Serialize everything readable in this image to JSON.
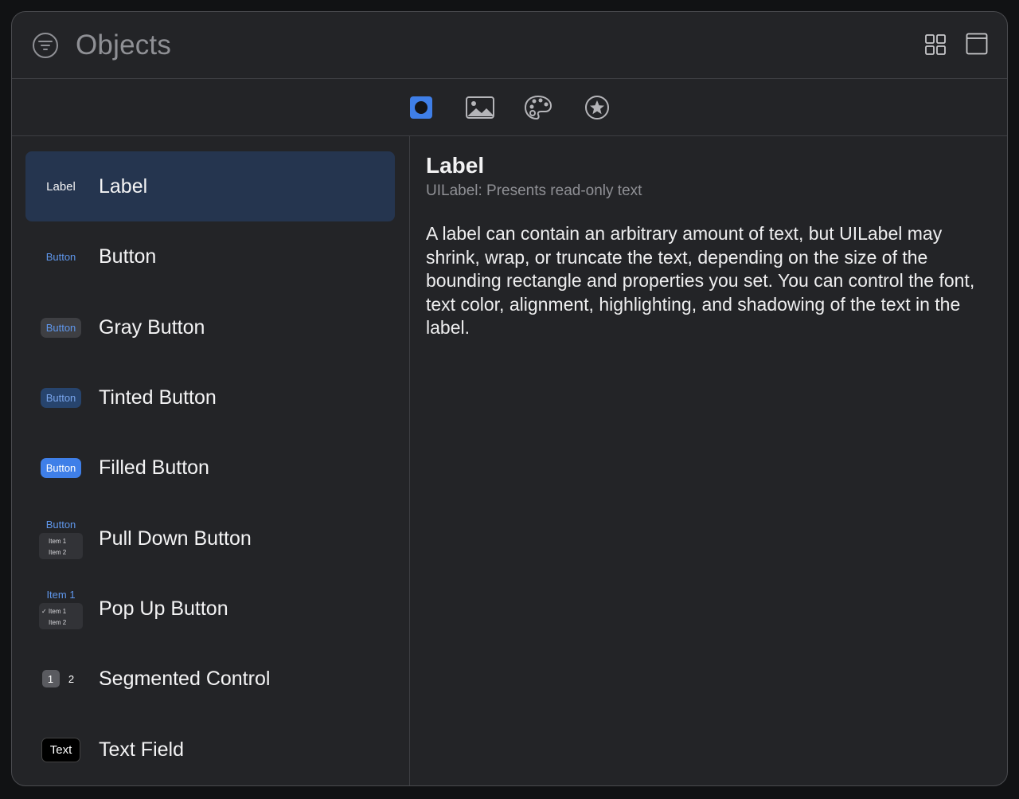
{
  "header": {
    "title": "Objects",
    "filter_icon": "filter-icon",
    "grid_icon": "grid-view-icon",
    "panel_icon": "panel-icon"
  },
  "tabs": [
    {
      "name": "objects-tab",
      "icon": "circle-in-square-icon",
      "selected": true
    },
    {
      "name": "media-tab",
      "icon": "photo-icon",
      "selected": false
    },
    {
      "name": "colors-tab",
      "icon": "palette-icon",
      "selected": false
    },
    {
      "name": "favorites-tab",
      "icon": "star-icon",
      "selected": false
    }
  ],
  "colors": {
    "accent": "#3f7fe8",
    "selection": "#25354f",
    "window": "#232427"
  },
  "library": {
    "items": [
      {
        "label": "Label",
        "thumb": "Label",
        "selected": true
      },
      {
        "label": "Button",
        "thumb": "Button"
      },
      {
        "label": "Gray Button",
        "thumb": "Button"
      },
      {
        "label": "Tinted Button",
        "thumb": "Button"
      },
      {
        "label": "Filled Button",
        "thumb": "Button"
      },
      {
        "label": "Pull Down Button",
        "thumb": "Button",
        "menu": [
          "Item 1",
          "Item 2"
        ]
      },
      {
        "label": "Pop Up Button",
        "thumb": "Item 1",
        "menu": [
          "✓ Item 1",
          "Item 2"
        ]
      },
      {
        "label": "Segmented Control",
        "segments": [
          "1",
          "2"
        ]
      },
      {
        "label": "Text Field",
        "thumb": "Text"
      }
    ]
  },
  "detail": {
    "title": "Label",
    "subtitle": "UILabel: Presents read-only text",
    "body": "A label can contain an arbitrary amount of text, but UILabel may shrink, wrap, or truncate the text, depending on the size of the bounding rectangle and properties you set. You can control the font, text color, alignment, highlighting, and shadowing of the text in the label."
  }
}
